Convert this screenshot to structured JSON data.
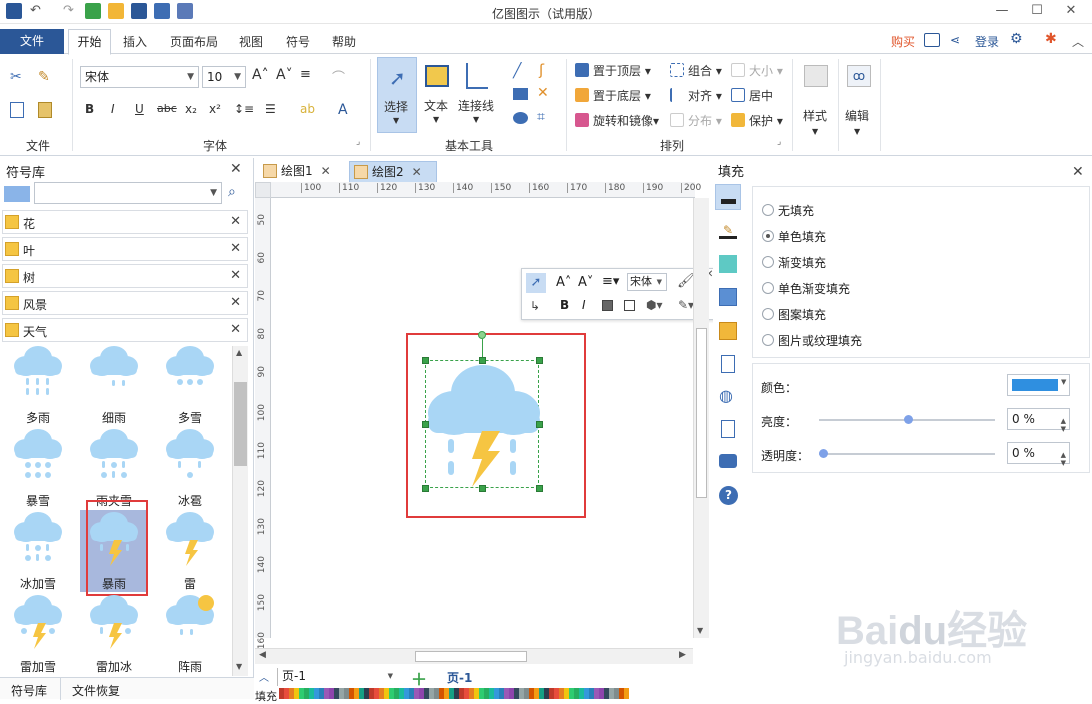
{
  "app_title": "亿图图示（试用版）",
  "menu": {
    "file": "文件",
    "tabs": [
      "开始",
      "插入",
      "页面布局",
      "视图",
      "符号",
      "帮助"
    ],
    "right": {
      "buy": "购买",
      "login": "登录"
    }
  },
  "ribbon": {
    "groups": {
      "file": "文件",
      "font": "字体",
      "basic_tools": "基本工具",
      "arrange": "排列"
    },
    "font_name": "宋体",
    "font_size": "10",
    "tools": {
      "select": "选择",
      "text": "文本",
      "connector": "连接线"
    },
    "arrange": {
      "bring_top": "置于顶层",
      "send_bottom": "置于底层",
      "rotate_mirror": "旋转和镜像",
      "group": "组合",
      "align": "对齐",
      "distribute": "分布",
      "size": "大小",
      "center": "居中",
      "protect": "保护"
    },
    "style": "样式",
    "edit": "编辑"
  },
  "library": {
    "title": "符号库",
    "search_placeholder": "",
    "categories": [
      "花",
      "叶",
      "树",
      "风景",
      "天气"
    ],
    "symbols": [
      "多雨",
      "细雨",
      "多雪",
      "暴雪",
      "雨夹雪",
      "冰雹",
      "冰加雪",
      "暴雨",
      "雷",
      "雷加雪",
      "雷加冰",
      "阵雨"
    ],
    "selected_symbol": "暴雨",
    "bottom_tabs": [
      "符号库",
      "文件恢复"
    ]
  },
  "documents": {
    "tabs": [
      "绘图1",
      "绘图2"
    ],
    "active": "绘图2"
  },
  "ruler": {
    "h_ticks": [
      "100",
      "110",
      "120",
      "130",
      "140",
      "150",
      "160",
      "170",
      "180",
      "190",
      "200"
    ],
    "v_ticks": [
      "50",
      "60",
      "70",
      "80",
      "90",
      "100",
      "110",
      "120",
      "130",
      "140",
      "150",
      "160"
    ]
  },
  "float_toolbar": {
    "font": "宋体"
  },
  "status": {
    "page_dropdown": "页-1",
    "page_tab": "页-1",
    "fill_label": "填充"
  },
  "fill_panel": {
    "title": "填充",
    "options": [
      "无填充",
      "单色填充",
      "渐变填充",
      "单色渐变填充",
      "图案填充",
      "图片或纹理填充"
    ],
    "selected": "单色填充",
    "color_label": "颜色：",
    "color_value": "#2f8fe0",
    "brightness_label": "亮度：",
    "brightness_value": "0 %",
    "transparency_label": "透明度：",
    "transparency_value": "0 %"
  },
  "colors": {
    "accent": "#2b5797",
    "highlight_red": "#e03b3b",
    "cloud": "#a9d6f5",
    "bolt": "#f6c542",
    "selection_green": "#3aa24a"
  },
  "watermark": "Baidu经验 jingyan.baidu.com"
}
